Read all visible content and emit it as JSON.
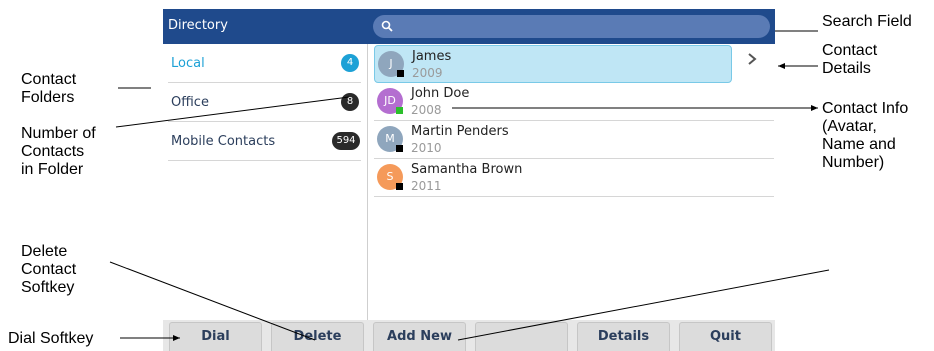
{
  "title": "Directory",
  "search": {
    "icon": "search-icon"
  },
  "folders": [
    {
      "name": "Local",
      "count": "4",
      "active": true
    },
    {
      "name": "Office",
      "count": "8",
      "active": false
    },
    {
      "name": "Mobile Contacts",
      "count": "594",
      "active": false
    }
  ],
  "contacts": [
    {
      "initials": "J",
      "name": "James",
      "number": "2009",
      "avatar_color": "#8fa6bd",
      "presence_color": "#000000",
      "selected": true
    },
    {
      "initials": "JD",
      "name": "John Doe",
      "number": "2008",
      "avatar_color": "#b46ed0",
      "presence_color": "#2bbf2b",
      "selected": false
    },
    {
      "initials": "M",
      "name": "Martin Penders",
      "number": "2010",
      "avatar_color": "#8fa6bd",
      "presence_color": "#000000",
      "selected": false
    },
    {
      "initials": "S",
      "name": "Samantha Brown",
      "number": "2011",
      "avatar_color": "#f59a5a",
      "presence_color": "#000000",
      "selected": false
    }
  ],
  "softkeys": [
    "Dial",
    "Delete",
    "Add New",
    "",
    "Details",
    "Quit"
  ],
  "callouts": {
    "search_field": "Search Field",
    "contact_details": "Contact\nDetails",
    "contact_info": "Contact Info\n(Avatar,\nName and\nNumber)",
    "contact_folders": "Contact\nFolders",
    "number_of_contacts": "Number of\nContacts\nin Folder",
    "delete_softkey": "Delete\nContact\nSoftkey",
    "dial_softkey": "Dial Softkey"
  },
  "colors": {
    "titlebar": "#1f4a8c",
    "accent": "#1da1d6",
    "selected_row": "#bfe6f5"
  }
}
